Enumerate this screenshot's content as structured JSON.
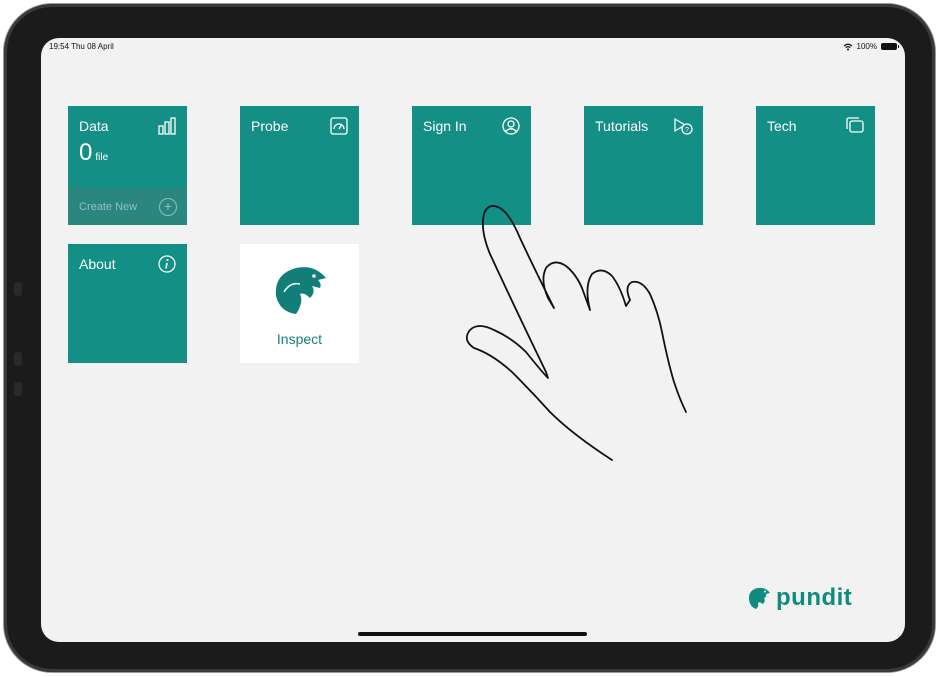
{
  "status_bar": {
    "time": "19:54 Thu 08 April",
    "battery": "100%"
  },
  "tiles": {
    "data": {
      "label": "Data",
      "count": "0",
      "unit": "file",
      "create_new": "Create New",
      "icon": "bar-chart-icon"
    },
    "probe": {
      "label": "Probe",
      "icon": "gauge-icon"
    },
    "sign_in": {
      "label": "Sign In",
      "icon": "user-icon"
    },
    "tutorials": {
      "label": "Tutorials",
      "icon": "play-help-icon"
    },
    "tech": {
      "label": "Tech",
      "icon": "cards-icon"
    },
    "about": {
      "label": "About",
      "icon": "info-icon"
    },
    "inspect": {
      "label": "Inspect",
      "icon": "eagle-logo"
    }
  },
  "brand": {
    "name": "pundit"
  },
  "colors": {
    "tile": "#138f85",
    "tile_footer": "#2b8680",
    "background": "#f2f2f2",
    "brand": "#0f8b80"
  }
}
